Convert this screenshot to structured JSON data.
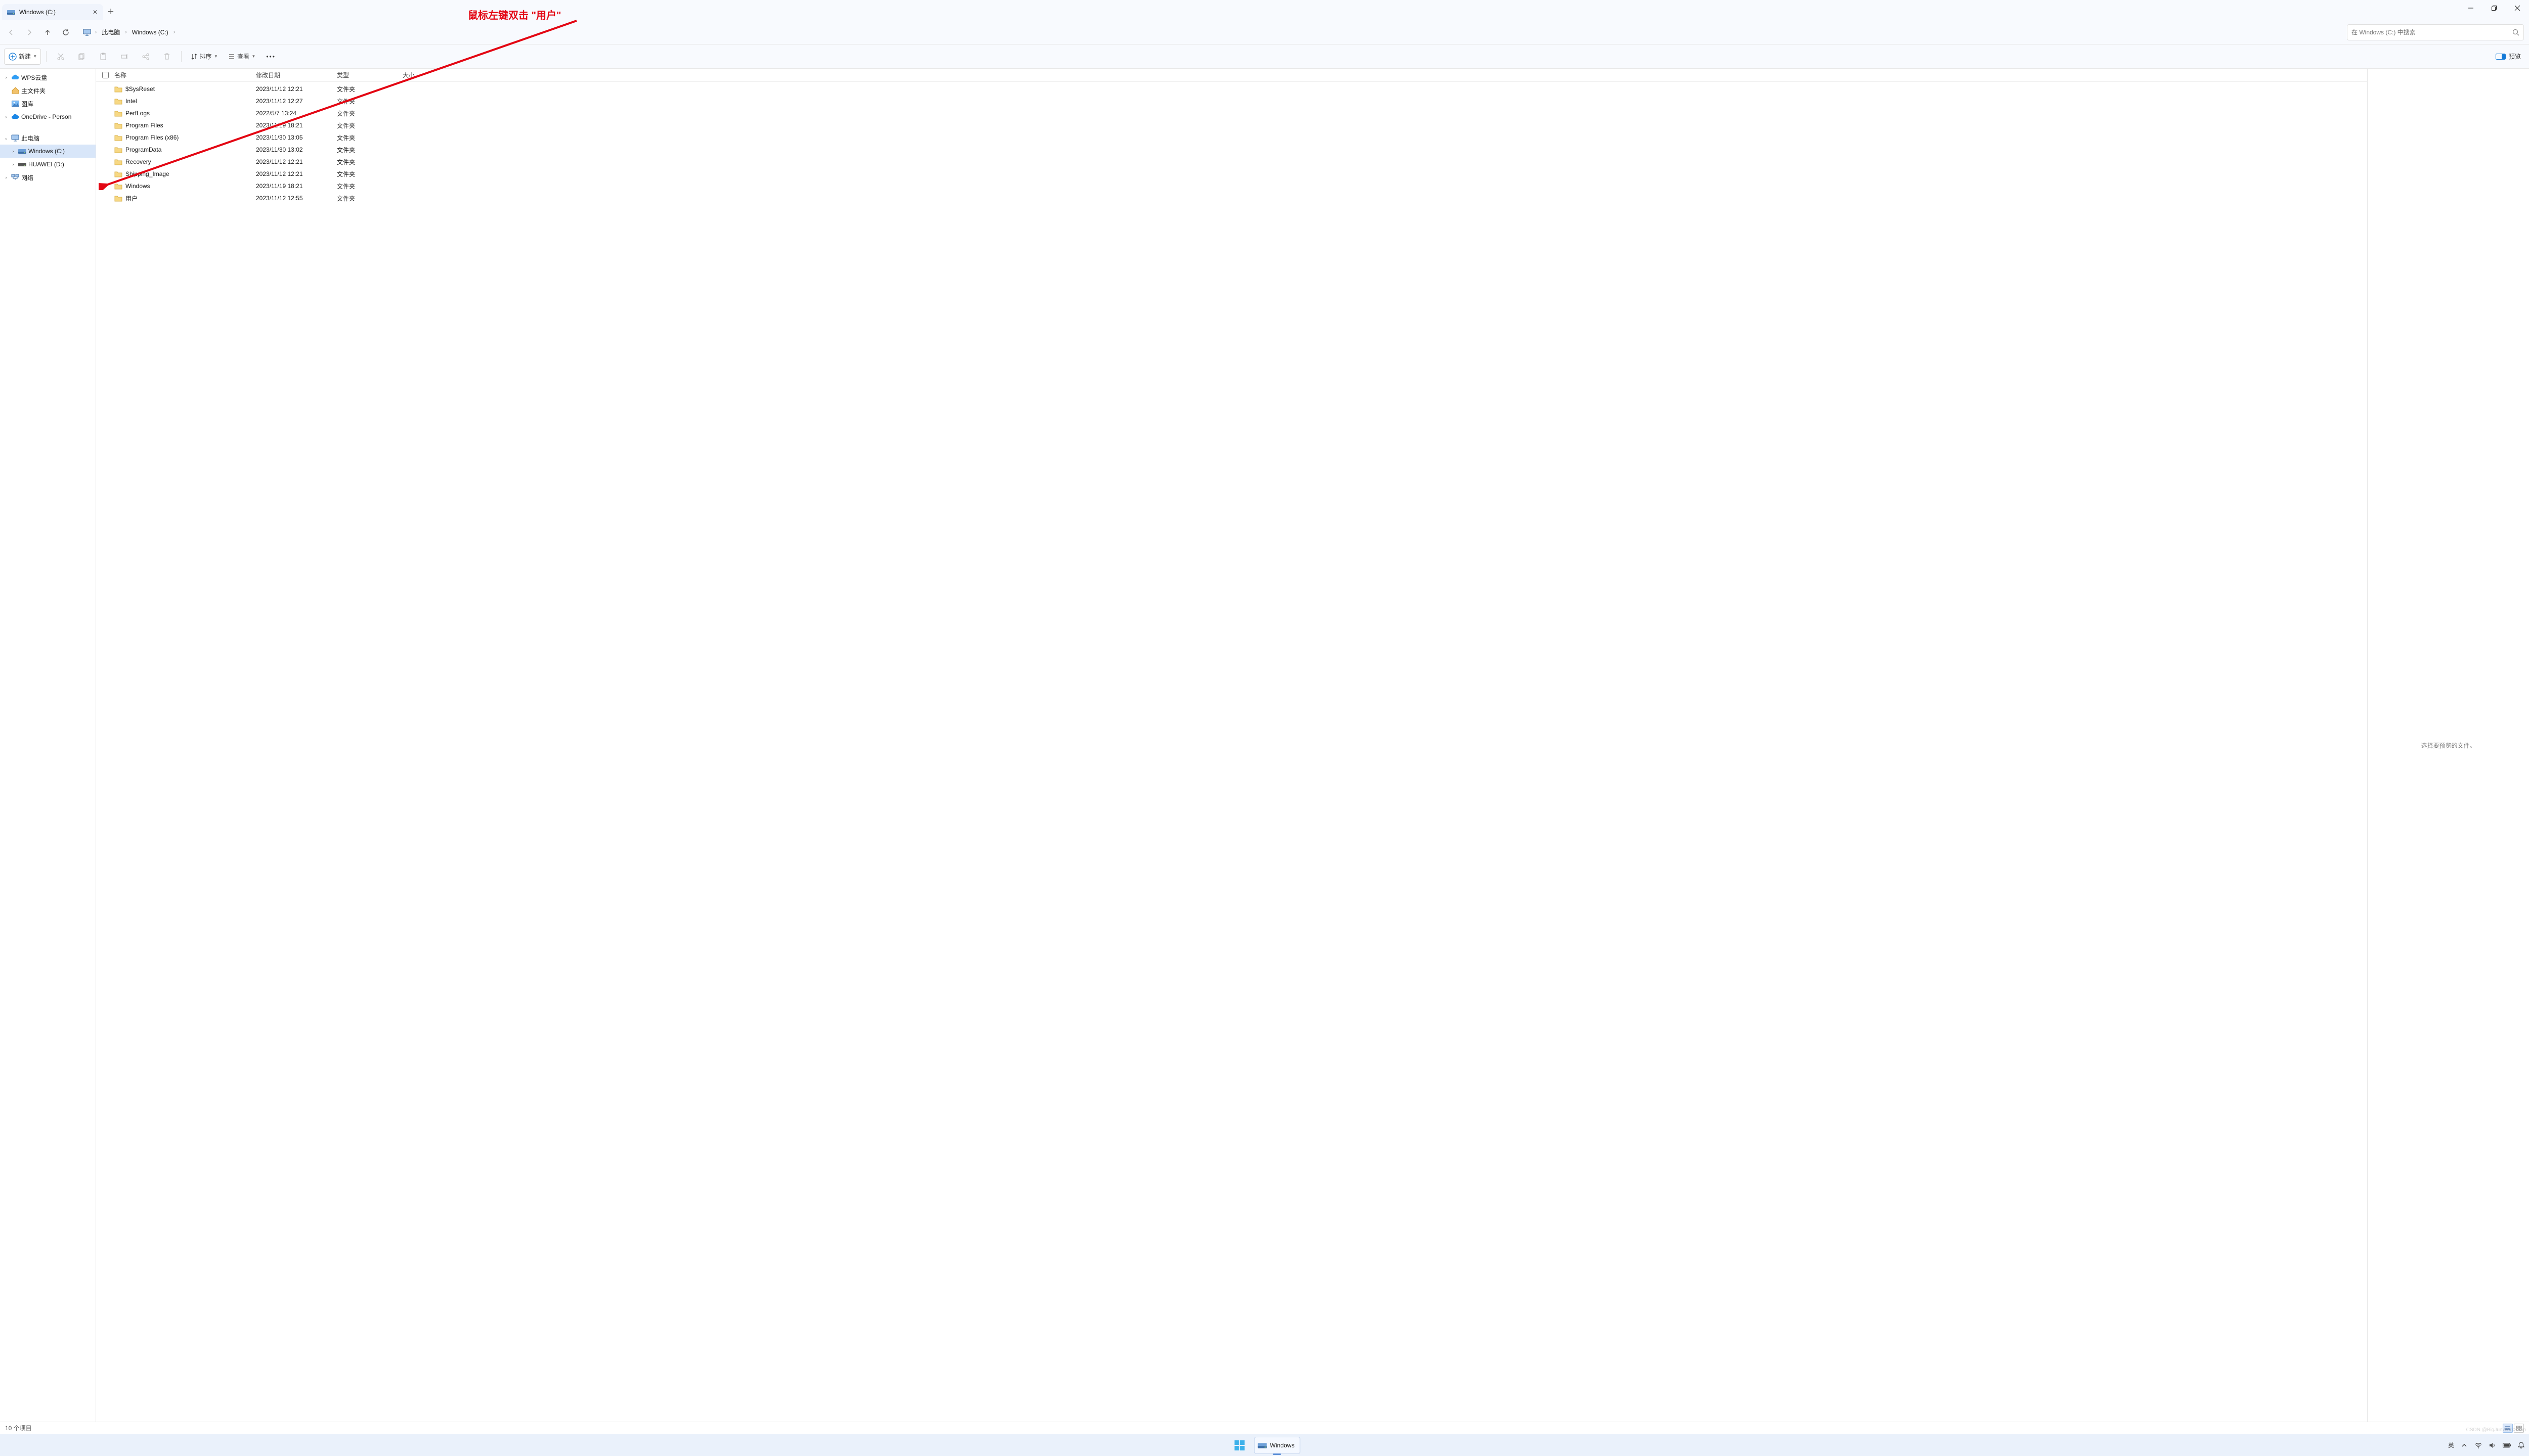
{
  "window": {
    "tab_title": "Windows (C:)",
    "new_label": "新建",
    "sort_label": "排序",
    "view_label": "查看",
    "preview_label": "预览"
  },
  "breadcrumb": {
    "pc": "此电脑",
    "drive": "Windows (C:)"
  },
  "search": {
    "placeholder": "在 Windows (C:) 中搜索"
  },
  "columns": {
    "name": "名称",
    "date": "修改日期",
    "type": "类型",
    "size": "大小"
  },
  "nav": {
    "wps": "WPS云盘",
    "home": "主文件夹",
    "gallery": "图库",
    "onedrive": "OneDrive - Person",
    "thispc": "此电脑",
    "drive_c": "Windows (C:)",
    "drive_d": "HUAWEI (D:)",
    "network": "网络"
  },
  "files": [
    {
      "name": "$SysReset",
      "date": "2023/11/12 12:21",
      "type": "文件夹",
      "size": ""
    },
    {
      "name": "Intel",
      "date": "2023/11/12 12:27",
      "type": "文件夹",
      "size": ""
    },
    {
      "name": "PerfLogs",
      "date": "2022/5/7 13:24",
      "type": "文件夹",
      "size": ""
    },
    {
      "name": "Program Files",
      "date": "2023/11/19 18:21",
      "type": "文件夹",
      "size": ""
    },
    {
      "name": "Program Files (x86)",
      "date": "2023/11/30 13:05",
      "type": "文件夹",
      "size": ""
    },
    {
      "name": "ProgramData",
      "date": "2023/11/30 13:02",
      "type": "文件夹",
      "size": ""
    },
    {
      "name": "Recovery",
      "date": "2023/11/12 12:21",
      "type": "文件夹",
      "size": ""
    },
    {
      "name": "Shipping_Image",
      "date": "2023/11/12 12:21",
      "type": "文件夹",
      "size": ""
    },
    {
      "name": "Windows",
      "date": "2023/11/19 18:21",
      "type": "文件夹",
      "size": ""
    },
    {
      "name": "用户",
      "date": "2023/11/12 12:55",
      "type": "文件夹",
      "size": ""
    }
  ],
  "preview_placeholder": "选择要预览的文件。",
  "status": {
    "count": "10 个项目"
  },
  "taskbar": {
    "running_label": "Windows",
    "ime": "英"
  },
  "annotation": {
    "text": "鼠标左键双击 \"用户\""
  },
  "watermark": "CSDN @BigJunWorkShop"
}
